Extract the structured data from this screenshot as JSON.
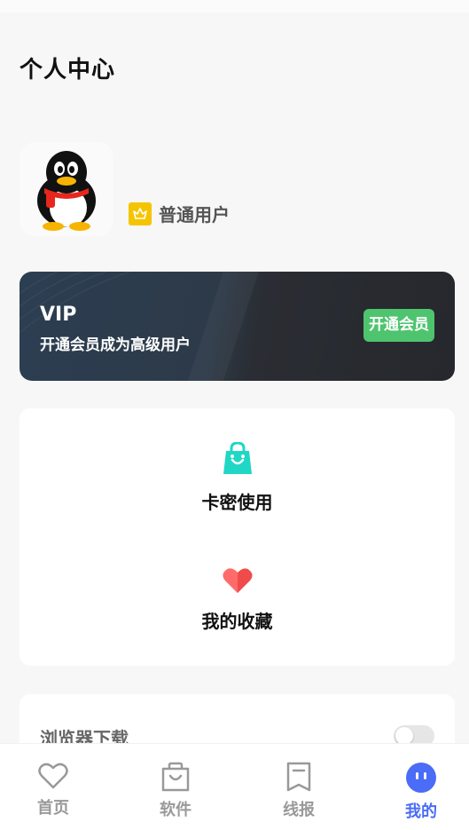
{
  "header": {
    "title": "个人中心"
  },
  "profile": {
    "avatar_icon": "qq-penguin-avatar",
    "level_icon": "crown-icon",
    "level_label": "普通用户"
  },
  "vip": {
    "title": "VIP",
    "subtitle": "开通会员成为高级用户",
    "button_label": "开通会员"
  },
  "menu": {
    "items": [
      {
        "label": "卡密使用",
        "icon": "shopping-bag-icon",
        "color": "#1fd7c4"
      },
      {
        "label": "我的收藏",
        "icon": "heart-icon",
        "color": "#f04b4b"
      }
    ]
  },
  "settings": {
    "browser_download_label": "浏览器下载",
    "browser_download_enabled": false
  },
  "tabbar": {
    "items": [
      {
        "label": "首页",
        "icon": "heart-outline-icon",
        "active": false
      },
      {
        "label": "软件",
        "icon": "bag-outline-icon",
        "active": false
      },
      {
        "label": "线报",
        "icon": "bookmark-outline-icon",
        "active": false
      },
      {
        "label": "我的",
        "icon": "face-icon",
        "active": true
      }
    ],
    "active_color": "#4a6cf7",
    "inactive_color": "#999999"
  }
}
